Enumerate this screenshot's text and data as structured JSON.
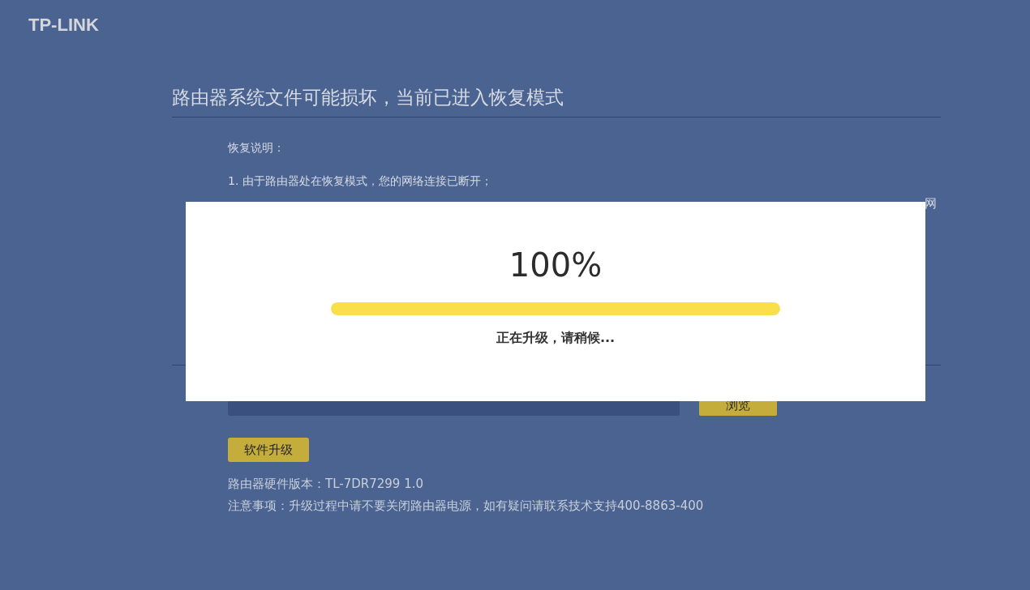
{
  "logo": "TP-LINK",
  "recovery": {
    "title": "路由器系统文件可能损坏，当前已进入恢复模式",
    "label": "恢复说明：",
    "lines": [
      "1. 由于路由器处在恢复模式，您的网络连接已断开；"
    ],
    "cut_fragment": "网"
  },
  "upgrade": {
    "browse_button": "浏览",
    "upgrade_button": "软件升级",
    "hardware": "路由器硬件版本：TL-7DR7299 1.0",
    "note": "注意事项：升级过程中请不要关闭路由器电源，如有疑问请联系技术支持400-8863-400"
  },
  "dialog": {
    "percent": "100%",
    "level": 1,
    "status": "正在升级，请稍候..."
  }
}
